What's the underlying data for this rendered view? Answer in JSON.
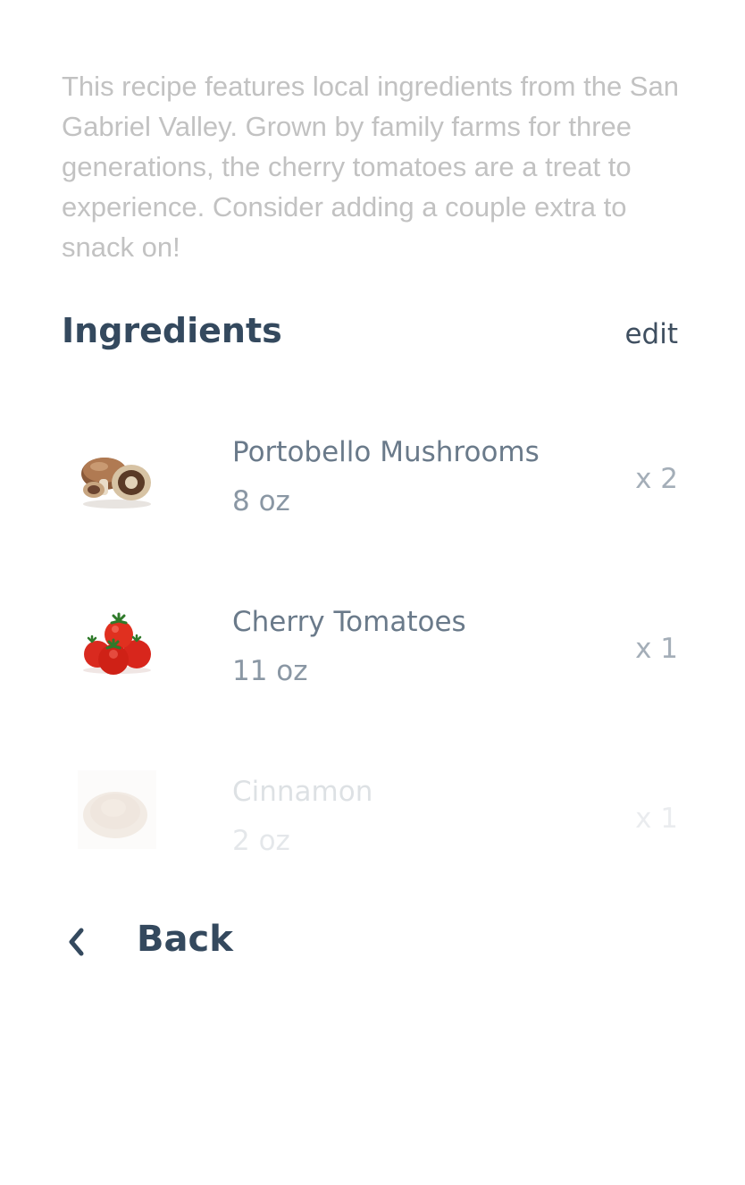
{
  "description": "This recipe features local ingredients from the San Gabriel Valley. Grown by family farms for three generations, the cherry tomatoes are a treat to experience. Consider adding a couple extra to snack on!",
  "ingredients_section": {
    "title": "Ingredients",
    "edit_label": "edit"
  },
  "ingredients": [
    {
      "name": "Portobello Mushrooms",
      "amount": "8 oz",
      "quantity": "x 2",
      "icon": "mushroom-icon"
    },
    {
      "name": "Cherry Tomatoes",
      "amount": "11 oz",
      "quantity": "x 1",
      "icon": "tomato-icon"
    },
    {
      "name": "Cinnamon",
      "amount": "2 oz",
      "quantity": "x 1",
      "icon": "cinnamon-powder-icon"
    }
  ],
  "navigation": {
    "back_label": "Back",
    "back_icon": "chevron-left-icon"
  },
  "colors": {
    "heading": "#34495e",
    "description": "#c2c2c2",
    "ingredient_name": "#6a7a8a",
    "background": "#ffffff"
  }
}
